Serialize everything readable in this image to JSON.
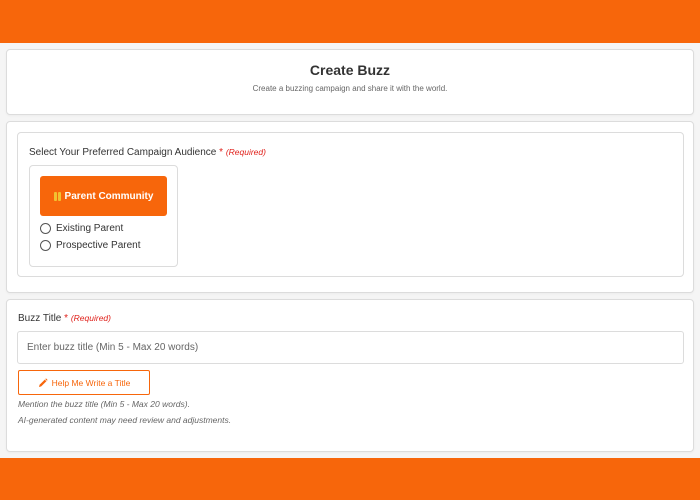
{
  "colors": {
    "accent": "#f7660b",
    "required": "#e0211b"
  },
  "header": {
    "title": "Create Buzz",
    "subtitle": "Create a buzzing campaign and share it with the world."
  },
  "audience": {
    "label": "Select Your Preferred Campaign Audience",
    "required_star": "*",
    "required_text": "(Required)",
    "community_button": {
      "label": "Parent Community",
      "icon": "people-icon"
    },
    "options": [
      {
        "label": "Existing Parent",
        "selected": false
      },
      {
        "label": "Prospective Parent",
        "selected": false
      }
    ]
  },
  "buzz_title": {
    "label": "Buzz Title",
    "required_star": "*",
    "required_text": "(Required)",
    "placeholder": "Enter buzz title (Min 5 - Max 20 words)",
    "value": "",
    "help_button": {
      "label": "Help Me Write a Title",
      "icon": "pencil-icon"
    },
    "hint_1": "Mention the buzz title (Min 5 - Max 20 words).",
    "hint_2": "AI-generated content may need review and adjustments."
  }
}
